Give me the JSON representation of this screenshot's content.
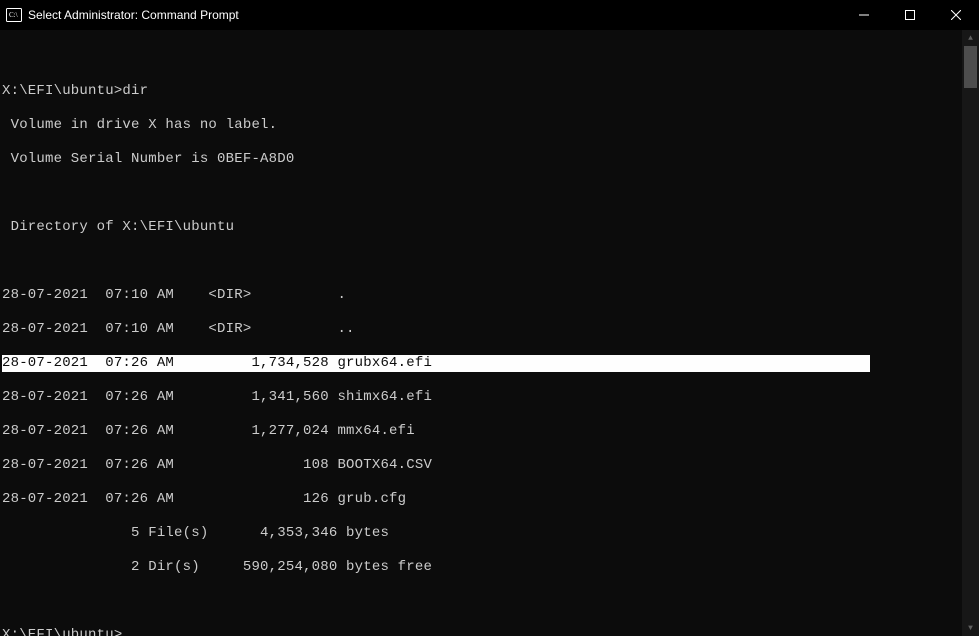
{
  "titlebar": {
    "title": "Select Administrator: Command Prompt"
  },
  "terminal": {
    "prompt1": "X:\\EFI\\ubuntu>",
    "command1": "dir",
    "volumeLabel": " Volume in drive X has no label.",
    "volumeSerial": " Volume Serial Number is 0BEF-A8D0",
    "directoryOf": " Directory of X:\\EFI\\ubuntu",
    "rows": [
      "28-07-2021  07:10 AM    <DIR>          .",
      "28-07-2021  07:10 AM    <DIR>          ..",
      "28-07-2021  07:26 AM         1,734,528 grubx64.efi",
      "28-07-2021  07:26 AM         1,341,560 shimx64.efi",
      "28-07-2021  07:26 AM         1,277,024 mmx64.efi",
      "28-07-2021  07:26 AM               108 BOOTX64.CSV",
      "28-07-2021  07:26 AM               126 grub.cfg"
    ],
    "summaryFiles": "               5 File(s)      4,353,346 bytes",
    "summaryDirs": "               2 Dir(s)     590,254,080 bytes free",
    "prompt2": "X:\\EFI\\ubuntu>"
  }
}
